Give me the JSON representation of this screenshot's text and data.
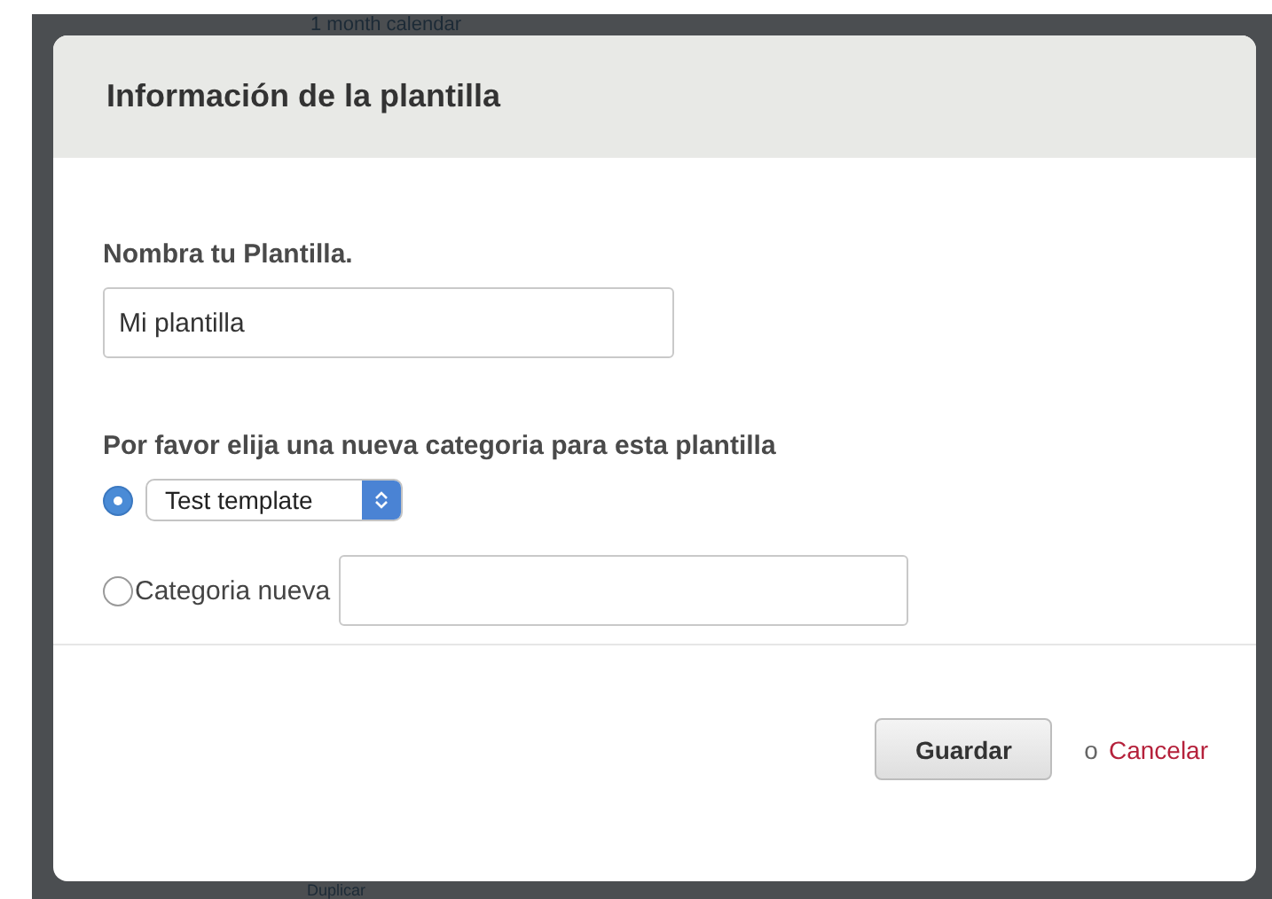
{
  "background": {
    "page_title": "1 month calendar",
    "link": "Duplicar"
  },
  "dialog": {
    "title": "Información de la plantilla",
    "name_label": "Nombra tu Plantilla.",
    "name_field": {
      "value": "Mi plantilla"
    },
    "category_label": "Por favor elija una nueva categoria para esta plantilla",
    "category_options": [
      {
        "kind": "select",
        "selected": true,
        "value": "Test template"
      },
      {
        "kind": "text",
        "selected": false,
        "label": "Categoria nueva"
      }
    ],
    "save_button": "Guardar",
    "separator": "o",
    "cancel_link": "Cancelar"
  }
}
